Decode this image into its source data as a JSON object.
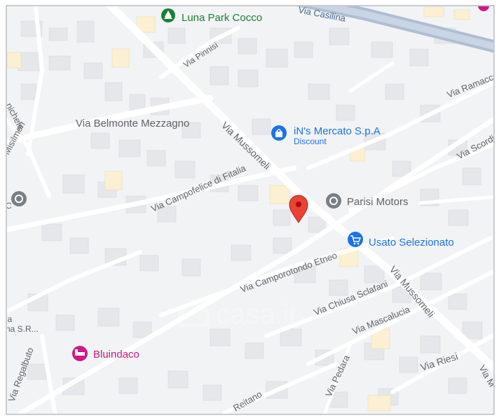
{
  "map": {
    "roads": {
      "via_casilina": "Via Casilina",
      "via_mussomeli": "Via Mussomeli",
      "via_mussomeli_2": "Via Mussomeli",
      "via_pinnisi": "Via Pinnisi",
      "via_belmonte_mezzagno": "Via Belmonte Mezzagno",
      "via_campofelice": "Via Campofelice di Fitalia",
      "via_camporotondo": "Via Camporotondo Etneo",
      "via_chiusa_sclafani": "Via Chiusa Sclafani",
      "via_mascalucia": "Via Mascalucia",
      "via_riesi": "Via Riesi",
      "via_pedara": "Via Pedara",
      "via_reitano": "Reitano",
      "via_ramacca": "Via Ramacca",
      "via_scordia": "Via Scordi",
      "via_negabuto": "Via Regalbuto",
      "via_nichele": "nichele",
      "via_misilmeri": "Misilmeri",
      "via_m_partial": "Via M"
    },
    "pois": {
      "luna_park": {
        "name": "Luna Park Cocco",
        "color": "#188038",
        "icon": "tree-icon"
      },
      "ins_mercato": {
        "name": "iN's Mercato S.p.A",
        "sub": "Discount",
        "color": "#1a73e8",
        "icon": "shopping-bag-icon"
      },
      "parisi_motors": {
        "name": "Parisi Motors",
        "color": "#5f6368",
        "icon": "place-icon"
      },
      "usato": {
        "name": "Usato Selezionato",
        "color": "#1a73e8",
        "icon": "shopping-cart-icon"
      },
      "bluindaco": {
        "name": "Bluindaco",
        "color": "#d01884",
        "icon": "bed-icon"
      },
      "left_poi_line1": "na S.R...",
      "left_poi_line2": "ia",
      "left_poi_letter": "C"
    },
    "pin": {
      "color": "#ea4335",
      "icon": "location-pin-icon"
    },
    "watermark": "casa.it",
    "colors": {
      "background": "#f1f3f4",
      "block": "#e8eaed",
      "road": "#ffffff",
      "highway": "#aebed3",
      "yellow_block": "#fbf0d1"
    }
  }
}
